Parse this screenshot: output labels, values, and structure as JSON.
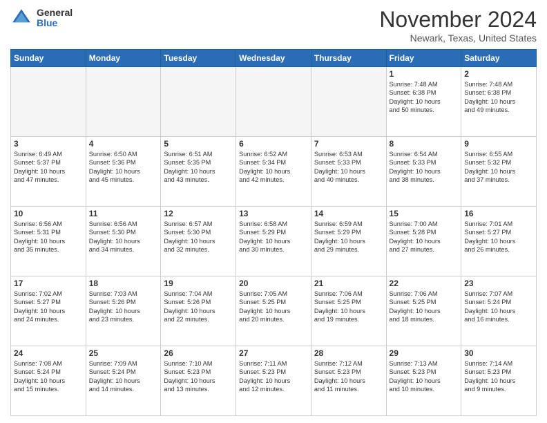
{
  "header": {
    "logo_general": "General",
    "logo_blue": "Blue",
    "month_title": "November 2024",
    "location": "Newark, Texas, United States"
  },
  "columns": [
    "Sunday",
    "Monday",
    "Tuesday",
    "Wednesday",
    "Thursday",
    "Friday",
    "Saturday"
  ],
  "weeks": [
    [
      {
        "day": "",
        "info": ""
      },
      {
        "day": "",
        "info": ""
      },
      {
        "day": "",
        "info": ""
      },
      {
        "day": "",
        "info": ""
      },
      {
        "day": "",
        "info": ""
      },
      {
        "day": "1",
        "info": "Sunrise: 7:48 AM\nSunset: 6:38 PM\nDaylight: 10 hours\nand 50 minutes."
      },
      {
        "day": "2",
        "info": "Sunrise: 7:48 AM\nSunset: 6:38 PM\nDaylight: 10 hours\nand 49 minutes."
      }
    ],
    [
      {
        "day": "3",
        "info": "Sunrise: 6:49 AM\nSunset: 5:37 PM\nDaylight: 10 hours\nand 47 minutes."
      },
      {
        "day": "4",
        "info": "Sunrise: 6:50 AM\nSunset: 5:36 PM\nDaylight: 10 hours\nand 45 minutes."
      },
      {
        "day": "5",
        "info": "Sunrise: 6:51 AM\nSunset: 5:35 PM\nDaylight: 10 hours\nand 43 minutes."
      },
      {
        "day": "6",
        "info": "Sunrise: 6:52 AM\nSunset: 5:34 PM\nDaylight: 10 hours\nand 42 minutes."
      },
      {
        "day": "7",
        "info": "Sunrise: 6:53 AM\nSunset: 5:33 PM\nDaylight: 10 hours\nand 40 minutes."
      },
      {
        "day": "8",
        "info": "Sunrise: 6:54 AM\nSunset: 5:33 PM\nDaylight: 10 hours\nand 38 minutes."
      },
      {
        "day": "9",
        "info": "Sunrise: 6:55 AM\nSunset: 5:32 PM\nDaylight: 10 hours\nand 37 minutes."
      }
    ],
    [
      {
        "day": "10",
        "info": "Sunrise: 6:56 AM\nSunset: 5:31 PM\nDaylight: 10 hours\nand 35 minutes."
      },
      {
        "day": "11",
        "info": "Sunrise: 6:56 AM\nSunset: 5:30 PM\nDaylight: 10 hours\nand 34 minutes."
      },
      {
        "day": "12",
        "info": "Sunrise: 6:57 AM\nSunset: 5:30 PM\nDaylight: 10 hours\nand 32 minutes."
      },
      {
        "day": "13",
        "info": "Sunrise: 6:58 AM\nSunset: 5:29 PM\nDaylight: 10 hours\nand 30 minutes."
      },
      {
        "day": "14",
        "info": "Sunrise: 6:59 AM\nSunset: 5:29 PM\nDaylight: 10 hours\nand 29 minutes."
      },
      {
        "day": "15",
        "info": "Sunrise: 7:00 AM\nSunset: 5:28 PM\nDaylight: 10 hours\nand 27 minutes."
      },
      {
        "day": "16",
        "info": "Sunrise: 7:01 AM\nSunset: 5:27 PM\nDaylight: 10 hours\nand 26 minutes."
      }
    ],
    [
      {
        "day": "17",
        "info": "Sunrise: 7:02 AM\nSunset: 5:27 PM\nDaylight: 10 hours\nand 24 minutes."
      },
      {
        "day": "18",
        "info": "Sunrise: 7:03 AM\nSunset: 5:26 PM\nDaylight: 10 hours\nand 23 minutes."
      },
      {
        "day": "19",
        "info": "Sunrise: 7:04 AM\nSunset: 5:26 PM\nDaylight: 10 hours\nand 22 minutes."
      },
      {
        "day": "20",
        "info": "Sunrise: 7:05 AM\nSunset: 5:25 PM\nDaylight: 10 hours\nand 20 minutes."
      },
      {
        "day": "21",
        "info": "Sunrise: 7:06 AM\nSunset: 5:25 PM\nDaylight: 10 hours\nand 19 minutes."
      },
      {
        "day": "22",
        "info": "Sunrise: 7:06 AM\nSunset: 5:25 PM\nDaylight: 10 hours\nand 18 minutes."
      },
      {
        "day": "23",
        "info": "Sunrise: 7:07 AM\nSunset: 5:24 PM\nDaylight: 10 hours\nand 16 minutes."
      }
    ],
    [
      {
        "day": "24",
        "info": "Sunrise: 7:08 AM\nSunset: 5:24 PM\nDaylight: 10 hours\nand 15 minutes."
      },
      {
        "day": "25",
        "info": "Sunrise: 7:09 AM\nSunset: 5:24 PM\nDaylight: 10 hours\nand 14 minutes."
      },
      {
        "day": "26",
        "info": "Sunrise: 7:10 AM\nSunset: 5:23 PM\nDaylight: 10 hours\nand 13 minutes."
      },
      {
        "day": "27",
        "info": "Sunrise: 7:11 AM\nSunset: 5:23 PM\nDaylight: 10 hours\nand 12 minutes."
      },
      {
        "day": "28",
        "info": "Sunrise: 7:12 AM\nSunset: 5:23 PM\nDaylight: 10 hours\nand 11 minutes."
      },
      {
        "day": "29",
        "info": "Sunrise: 7:13 AM\nSunset: 5:23 PM\nDaylight: 10 hours\nand 10 minutes."
      },
      {
        "day": "30",
        "info": "Sunrise: 7:14 AM\nSunset: 5:23 PM\nDaylight: 10 hours\nand 9 minutes."
      }
    ]
  ]
}
